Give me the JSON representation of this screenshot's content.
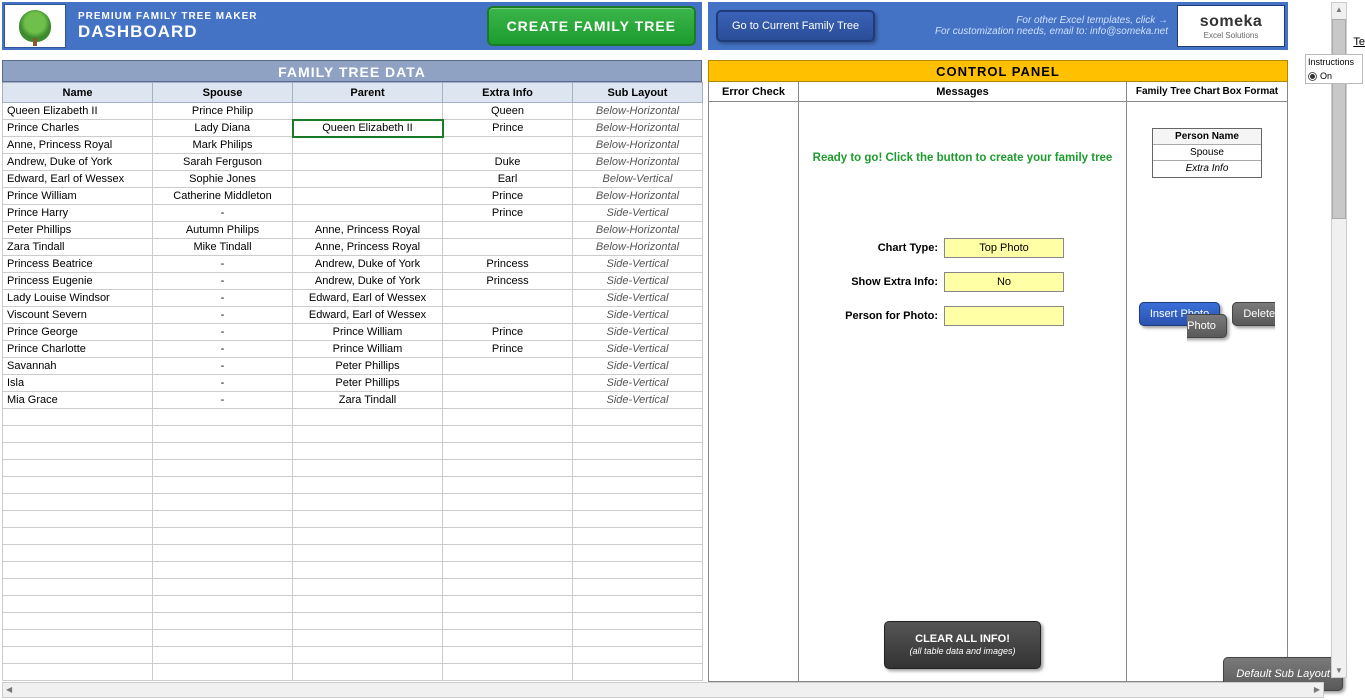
{
  "header": {
    "subtitle": "PREMIUM FAMILY TREE MAKER",
    "title": "DASHBOARD",
    "create_btn": "CREATE FAMILY TREE",
    "goto_btn": "Go to Current Family Tree",
    "info_line1": "For other Excel templates, click →",
    "info_line2": "For customization needs, email to: info@someka.net",
    "brand": "someka",
    "brand_sub": "Excel Solutions"
  },
  "sections": {
    "data_title": "FAMILY TREE DATA",
    "control_title": "CONTROL PANEL"
  },
  "columns": {
    "name": "Name",
    "spouse": "Spouse",
    "parent": "Parent",
    "extra": "Extra Info",
    "layout": "Sub Layout"
  },
  "rows": [
    {
      "name": "Queen Elizabeth II",
      "spouse": "Prince Philip",
      "parent": "",
      "extra": "Queen",
      "layout": "Below-Horizontal"
    },
    {
      "name": "Prince Charles",
      "spouse": "Lady Diana",
      "parent": "Queen Elizabeth II",
      "extra": "Prince",
      "layout": "Below-Horizontal"
    },
    {
      "name": "Anne, Princess Royal",
      "spouse": "Mark Philips",
      "parent": "",
      "extra": "",
      "layout": "Below-Horizontal"
    },
    {
      "name": "Andrew, Duke of York",
      "spouse": "Sarah Ferguson",
      "parent": "",
      "extra": "Duke",
      "layout": "Below-Horizontal"
    },
    {
      "name": "Edward, Earl of Wessex",
      "spouse": "Sophie Jones",
      "parent": "",
      "extra": "Earl",
      "layout": "Below-Vertical"
    },
    {
      "name": "Prince William",
      "spouse": "Catherine Middleton",
      "parent": "",
      "extra": "Prince",
      "layout": "Below-Horizontal"
    },
    {
      "name": "Prince Harry",
      "spouse": "-",
      "parent": "",
      "extra": "Prince",
      "layout": "Side-Vertical"
    },
    {
      "name": "Peter Phillips",
      "spouse": "Autumn Philips",
      "parent": "Anne, Princess Royal",
      "extra": "",
      "layout": "Below-Horizontal"
    },
    {
      "name": "Zara Tindall",
      "spouse": "Mike Tindall",
      "parent": "Anne, Princess Royal",
      "extra": "",
      "layout": "Below-Horizontal"
    },
    {
      "name": "Princess Beatrice",
      "spouse": "-",
      "parent": "Andrew, Duke of York",
      "extra": "Princess",
      "layout": "Side-Vertical"
    },
    {
      "name": "Princess Eugenie",
      "spouse": "-",
      "parent": "Andrew, Duke of York",
      "extra": "Princess",
      "layout": "Side-Vertical"
    },
    {
      "name": "Lady Louise Windsor",
      "spouse": "-",
      "parent": "Edward, Earl of Wessex",
      "extra": "",
      "layout": "Side-Vertical"
    },
    {
      "name": "Viscount Severn",
      "spouse": "-",
      "parent": "Edward, Earl of Wessex",
      "extra": "",
      "layout": "Side-Vertical"
    },
    {
      "name": "Prince George",
      "spouse": "-",
      "parent": "Prince William",
      "extra": "Prince",
      "layout": "Side-Vertical"
    },
    {
      "name": "Prince Charlotte",
      "spouse": "-",
      "parent": "Prince William",
      "extra": "Prince",
      "layout": "Side-Vertical"
    },
    {
      "name": "Savannah",
      "spouse": "-",
      "parent": "Peter Phillips",
      "extra": "",
      "layout": "Side-Vertical"
    },
    {
      "name": "Isla",
      "spouse": "-",
      "parent": "Peter Phillips",
      "extra": "",
      "layout": "Side-Vertical"
    },
    {
      "name": "Mia Grace",
      "spouse": "-",
      "parent": "Zara Tindall",
      "extra": "",
      "layout": "Side-Vertical"
    }
  ],
  "dropdown": {
    "options": [
      "Queen Elizabeth II",
      "Prince Charles",
      "Anne, Princess Royal",
      "Andrew, Duke of York",
      "Edward, Earl of Wessex",
      "Prince William",
      "Prince Harry",
      "Peter Phillips"
    ],
    "selected": "Queen Elizabeth II"
  },
  "control": {
    "error_check": "Error Check",
    "messages": "Messages",
    "format_header": "Family Tree Chart Box Format",
    "ready_msg": "Ready to go! Click the button to create your family tree",
    "chart_type_label": "Chart Type:",
    "chart_type_value": "Top Photo",
    "show_extra_label": "Show Extra Info:",
    "show_extra_value": "No",
    "person_photo_label": "Person for Photo:",
    "person_photo_value": "",
    "insert_photo": "Insert Photo",
    "delete_photo": "Delete Photo",
    "clear_title": "CLEAR ALL INFO!",
    "clear_sub": "(all table data and images)",
    "default_layout": "Default Sub Layout",
    "box_person": "Person Name",
    "box_spouse": "Spouse",
    "box_extra": "Extra Info"
  },
  "sidebar": {
    "instructions": "Instructions",
    "on": "On",
    "te": "Te"
  }
}
